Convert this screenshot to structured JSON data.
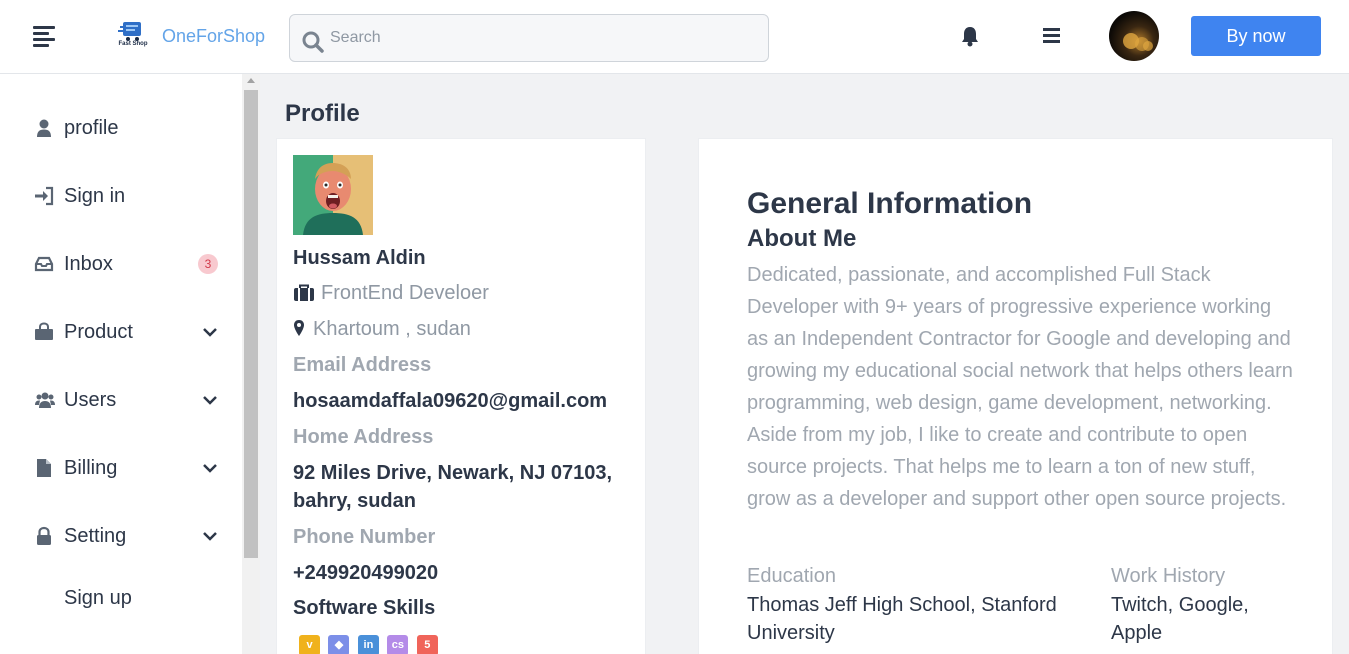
{
  "header": {
    "brand": "OneForShop",
    "logo_caption": "Fast Shop",
    "search_placeholder": "Search",
    "buy_button": "By now"
  },
  "sidebar": {
    "items": [
      {
        "label": "profile",
        "icon": "user-icon",
        "has_chevron": false
      },
      {
        "label": "Sign in",
        "icon": "sign-in-icon",
        "has_chevron": false
      },
      {
        "label": "Inbox",
        "icon": "inbox-icon",
        "badge": "3",
        "has_chevron": false
      },
      {
        "label": "Product",
        "icon": "shopping-bag-icon",
        "has_chevron": true
      },
      {
        "label": "Users",
        "icon": "users-icon",
        "has_chevron": true
      },
      {
        "label": "Billing",
        "icon": "file-icon",
        "has_chevron": true
      },
      {
        "label": "Setting",
        "icon": "lock-icon",
        "has_chevron": true
      },
      {
        "label": "Sign up",
        "icon": "",
        "has_chevron": false
      }
    ]
  },
  "main": {
    "page_title": "Profile",
    "profile": {
      "name": "Hussam Aldin",
      "role": "FrontEnd Develoer",
      "location": "Khartoum , sudan",
      "email_label": "Email Address",
      "email": "hosaamdaffala09620@gmail.com",
      "home_label": "Home Address",
      "home": "92 Miles Drive, Newark, NJ 07103, bahry, sudan",
      "phone_label": "Phone Number",
      "phone": "+249920499020",
      "skills_title": "Software Skills",
      "skills": [
        {
          "name": "vimeo-icon",
          "glyph": "v",
          "color": "#f0b21c"
        },
        {
          "name": "git-icon",
          "glyph": "◆",
          "color": "#7c8fe8"
        },
        {
          "name": "linkedin-icon",
          "glyph": "in",
          "color": "#4a90d9"
        },
        {
          "name": "css-icon",
          "glyph": "cs",
          "color": "#b48be8"
        },
        {
          "name": "html5-icon",
          "glyph": "5",
          "color": "#f0645a"
        }
      ]
    },
    "general": {
      "title": "General Information",
      "about_title": "About Me",
      "about_text": "Dedicated, passionate, and accomplished Full Stack Developer with 9+ years of progressive experience working as an Independent Contractor for Google and developing and growing my educational social network that helps others learn programming, web design, game development, networking. Aside from my job, I like to create and contribute to open source projects. That helps me to learn a ton of new stuff, grow as a developer and support other open source projects.",
      "education_label": "Education",
      "education": "Thomas Jeff High School, Stanford University",
      "work_label": "Work History",
      "work": "Twitch, Google, Apple"
    }
  },
  "colors": {
    "accent": "#3f84f0",
    "brand": "#63a4e8",
    "badge_bg": "#f8c9cf",
    "badge_text": "#d23a4b",
    "muted": "#a0a7b0"
  }
}
